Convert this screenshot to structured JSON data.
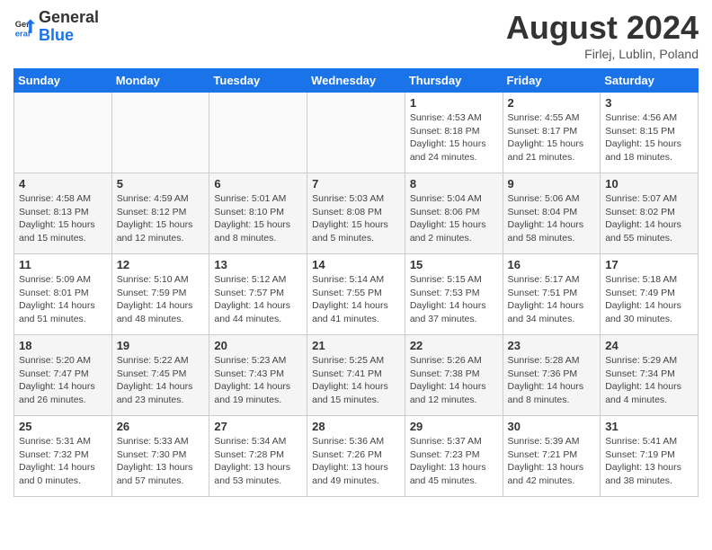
{
  "header": {
    "logo_line1": "General",
    "logo_line2": "Blue",
    "month": "August 2024",
    "location": "Firlej, Lublin, Poland"
  },
  "days_of_week": [
    "Sunday",
    "Monday",
    "Tuesday",
    "Wednesday",
    "Thursday",
    "Friday",
    "Saturday"
  ],
  "weeks": [
    [
      {
        "day": "",
        "info": ""
      },
      {
        "day": "",
        "info": ""
      },
      {
        "day": "",
        "info": ""
      },
      {
        "day": "",
        "info": ""
      },
      {
        "day": "1",
        "info": "Sunrise: 4:53 AM\nSunset: 8:18 PM\nDaylight: 15 hours\nand 24 minutes."
      },
      {
        "day": "2",
        "info": "Sunrise: 4:55 AM\nSunset: 8:17 PM\nDaylight: 15 hours\nand 21 minutes."
      },
      {
        "day": "3",
        "info": "Sunrise: 4:56 AM\nSunset: 8:15 PM\nDaylight: 15 hours\nand 18 minutes."
      }
    ],
    [
      {
        "day": "4",
        "info": "Sunrise: 4:58 AM\nSunset: 8:13 PM\nDaylight: 15 hours\nand 15 minutes."
      },
      {
        "day": "5",
        "info": "Sunrise: 4:59 AM\nSunset: 8:12 PM\nDaylight: 15 hours\nand 12 minutes."
      },
      {
        "day": "6",
        "info": "Sunrise: 5:01 AM\nSunset: 8:10 PM\nDaylight: 15 hours\nand 8 minutes."
      },
      {
        "day": "7",
        "info": "Sunrise: 5:03 AM\nSunset: 8:08 PM\nDaylight: 15 hours\nand 5 minutes."
      },
      {
        "day": "8",
        "info": "Sunrise: 5:04 AM\nSunset: 8:06 PM\nDaylight: 15 hours\nand 2 minutes."
      },
      {
        "day": "9",
        "info": "Sunrise: 5:06 AM\nSunset: 8:04 PM\nDaylight: 14 hours\nand 58 minutes."
      },
      {
        "day": "10",
        "info": "Sunrise: 5:07 AM\nSunset: 8:02 PM\nDaylight: 14 hours\nand 55 minutes."
      }
    ],
    [
      {
        "day": "11",
        "info": "Sunrise: 5:09 AM\nSunset: 8:01 PM\nDaylight: 14 hours\nand 51 minutes."
      },
      {
        "day": "12",
        "info": "Sunrise: 5:10 AM\nSunset: 7:59 PM\nDaylight: 14 hours\nand 48 minutes."
      },
      {
        "day": "13",
        "info": "Sunrise: 5:12 AM\nSunset: 7:57 PM\nDaylight: 14 hours\nand 44 minutes."
      },
      {
        "day": "14",
        "info": "Sunrise: 5:14 AM\nSunset: 7:55 PM\nDaylight: 14 hours\nand 41 minutes."
      },
      {
        "day": "15",
        "info": "Sunrise: 5:15 AM\nSunset: 7:53 PM\nDaylight: 14 hours\nand 37 minutes."
      },
      {
        "day": "16",
        "info": "Sunrise: 5:17 AM\nSunset: 7:51 PM\nDaylight: 14 hours\nand 34 minutes."
      },
      {
        "day": "17",
        "info": "Sunrise: 5:18 AM\nSunset: 7:49 PM\nDaylight: 14 hours\nand 30 minutes."
      }
    ],
    [
      {
        "day": "18",
        "info": "Sunrise: 5:20 AM\nSunset: 7:47 PM\nDaylight: 14 hours\nand 26 minutes."
      },
      {
        "day": "19",
        "info": "Sunrise: 5:22 AM\nSunset: 7:45 PM\nDaylight: 14 hours\nand 23 minutes."
      },
      {
        "day": "20",
        "info": "Sunrise: 5:23 AM\nSunset: 7:43 PM\nDaylight: 14 hours\nand 19 minutes."
      },
      {
        "day": "21",
        "info": "Sunrise: 5:25 AM\nSunset: 7:41 PM\nDaylight: 14 hours\nand 15 minutes."
      },
      {
        "day": "22",
        "info": "Sunrise: 5:26 AM\nSunset: 7:38 PM\nDaylight: 14 hours\nand 12 minutes."
      },
      {
        "day": "23",
        "info": "Sunrise: 5:28 AM\nSunset: 7:36 PM\nDaylight: 14 hours\nand 8 minutes."
      },
      {
        "day": "24",
        "info": "Sunrise: 5:29 AM\nSunset: 7:34 PM\nDaylight: 14 hours\nand 4 minutes."
      }
    ],
    [
      {
        "day": "25",
        "info": "Sunrise: 5:31 AM\nSunset: 7:32 PM\nDaylight: 14 hours\nand 0 minutes."
      },
      {
        "day": "26",
        "info": "Sunrise: 5:33 AM\nSunset: 7:30 PM\nDaylight: 13 hours\nand 57 minutes."
      },
      {
        "day": "27",
        "info": "Sunrise: 5:34 AM\nSunset: 7:28 PM\nDaylight: 13 hours\nand 53 minutes."
      },
      {
        "day": "28",
        "info": "Sunrise: 5:36 AM\nSunset: 7:26 PM\nDaylight: 13 hours\nand 49 minutes."
      },
      {
        "day": "29",
        "info": "Sunrise: 5:37 AM\nSunset: 7:23 PM\nDaylight: 13 hours\nand 45 minutes."
      },
      {
        "day": "30",
        "info": "Sunrise: 5:39 AM\nSunset: 7:21 PM\nDaylight: 13 hours\nand 42 minutes."
      },
      {
        "day": "31",
        "info": "Sunrise: 5:41 AM\nSunset: 7:19 PM\nDaylight: 13 hours\nand 38 minutes."
      }
    ]
  ]
}
